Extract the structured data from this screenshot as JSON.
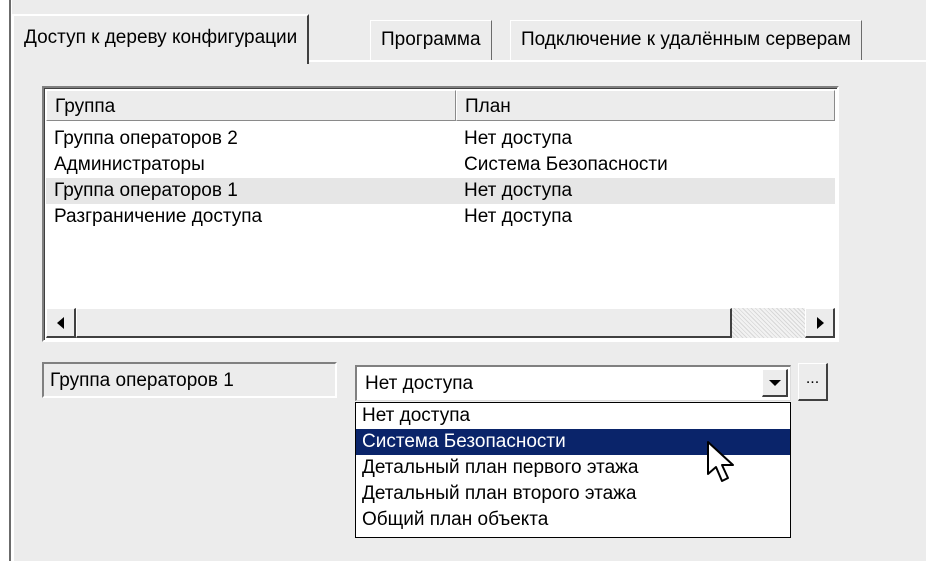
{
  "tabs": [
    {
      "label": "Доступ к дереву конфигурации",
      "active": true
    },
    {
      "label": "Программа",
      "active": false
    },
    {
      "label": "Подключение к удалённым серверам",
      "active": false
    }
  ],
  "list": {
    "columns": [
      "Группа",
      "План"
    ],
    "rows": [
      {
        "group": "Группа операторов 2",
        "plan": "Нет доступа",
        "selected": false
      },
      {
        "group": "Администраторы",
        "plan": "Система Безопасности",
        "selected": false
      },
      {
        "group": "Группа операторов 1",
        "plan": "Нет доступа",
        "selected": true
      },
      {
        "group": "Разграничение доступа",
        "plan": "Нет доступа",
        "selected": false
      }
    ]
  },
  "selected_group": "Группа операторов 1",
  "plan_combo": {
    "value": "Нет доступа",
    "ellipsis_label": "...",
    "options": [
      "Нет доступа",
      "Система Безопасности",
      "Детальный план первого этажа",
      "Детальный план второго этажа",
      "Общий план объекта"
    ],
    "highlighted_index": 1
  },
  "colors": {
    "panel_bg": "#ececec",
    "highlight_bg": "#0a246a",
    "selected_row_bg": "#e6e6e6"
  },
  "icons": {
    "scroll_left": "triangle-left-icon",
    "scroll_right": "triangle-right-icon",
    "combo_arrow": "chevron-down-icon",
    "cursor": "mouse-pointer-icon"
  }
}
